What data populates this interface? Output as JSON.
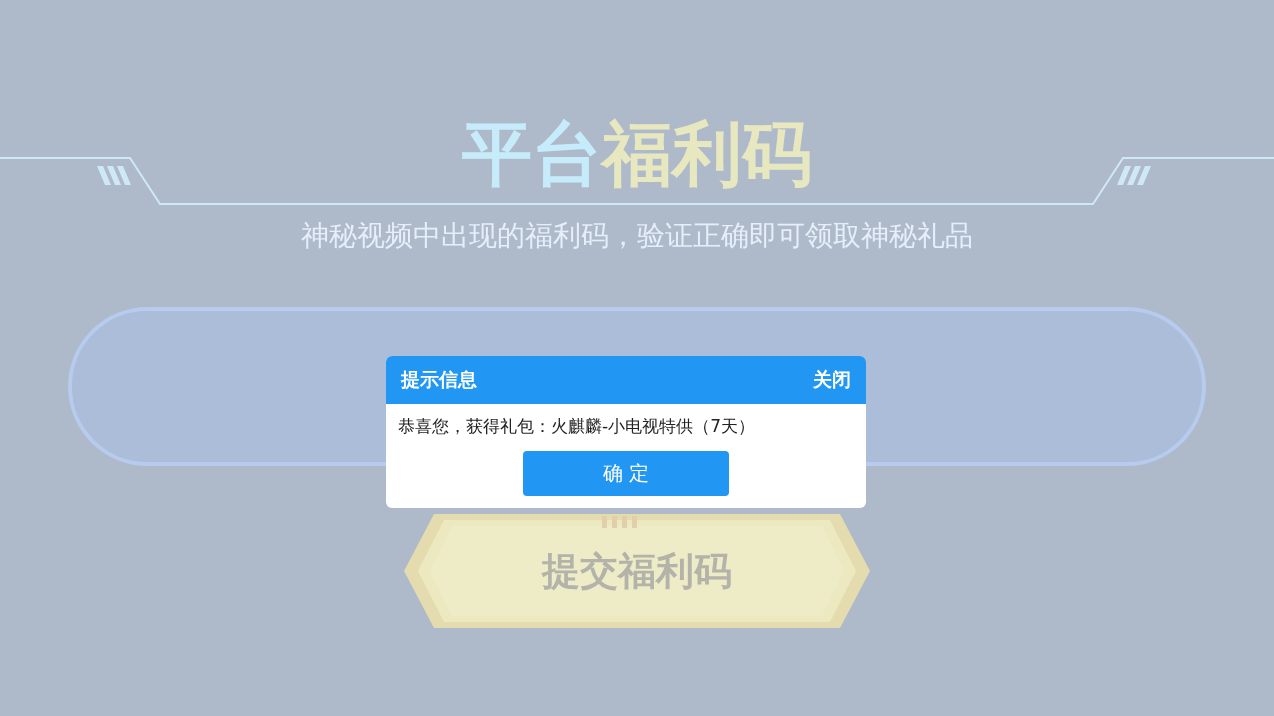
{
  "header": {
    "title_parts": [
      {
        "text": "平台",
        "kind": "accent"
      },
      {
        "text": "福利码",
        "kind": "highlight"
      }
    ],
    "subtitle": "神秘视频中出现的福利码，验证正确即可领取神秘礼品"
  },
  "submit_button": "提交福利码",
  "dialog": {
    "title": "提示信息",
    "close": "关闭",
    "message": "恭喜您，获得礼包：火麒麟-小电视特供（7天）",
    "confirm": "确 定"
  }
}
